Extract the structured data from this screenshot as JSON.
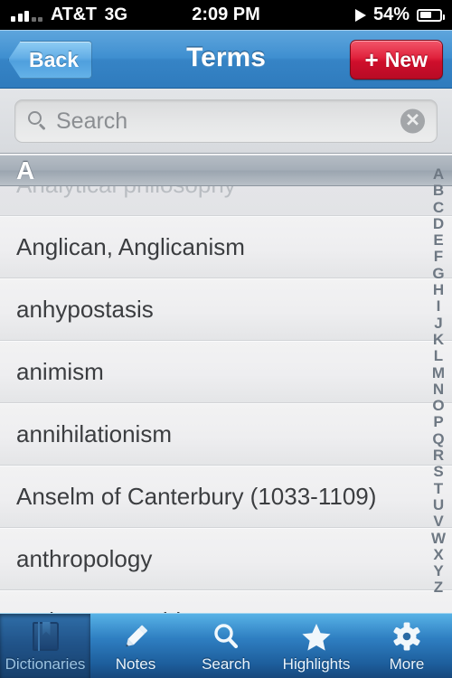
{
  "status_bar": {
    "carrier": "AT&T",
    "network": "3G",
    "time": "2:09 PM",
    "battery_percent": "54%",
    "play_icon": "play-icon",
    "battery_icon": "battery-icon",
    "signal_icon": "signal-bars-icon"
  },
  "nav_bar": {
    "back_label": "Back",
    "title": "Terms",
    "new_label": "New",
    "new_plus": "+",
    "accent_blue": "#3684c6",
    "accent_red": "#cf0f2c"
  },
  "search": {
    "placeholder": "Search",
    "value": "",
    "search_icon": "search-icon",
    "clear_icon": "clear-circle-icon",
    "clear_glyph": "✕"
  },
  "list": {
    "section_header": "A",
    "rows": [
      {
        "label": "Analytical philosophy",
        "partial": true
      },
      {
        "label": "Anglican, Anglicanism",
        "partial": false
      },
      {
        "label": "anhypostasis",
        "partial": false
      },
      {
        "label": "animism",
        "partial": false
      },
      {
        "label": "annihilationism",
        "partial": false
      },
      {
        "label": "Anselm of Canterbury (1033-1109)",
        "partial": false
      },
      {
        "label": "anthropology",
        "partial": false
      },
      {
        "label": "anthropomorphism",
        "partial": false
      }
    ]
  },
  "index_bar": {
    "letters": [
      "A",
      "B",
      "C",
      "D",
      "E",
      "F",
      "G",
      "H",
      "I",
      "J",
      "K",
      "L",
      "M",
      "N",
      "O",
      "P",
      "Q",
      "R",
      "S",
      "T",
      "U",
      "V",
      "W",
      "X",
      "Y",
      "Z"
    ]
  },
  "tab_bar": {
    "selected": "Dictionaries",
    "tabs": [
      {
        "label": "Dictionaries",
        "icon": "book-icon",
        "selected": true
      },
      {
        "label": "Notes",
        "icon": "pencil-icon",
        "selected": false
      },
      {
        "label": "Search",
        "icon": "search-icon",
        "selected": false
      },
      {
        "label": "Highlights",
        "icon": "star-icon",
        "selected": false
      },
      {
        "label": "More",
        "icon": "gear-icon",
        "selected": false
      }
    ]
  }
}
